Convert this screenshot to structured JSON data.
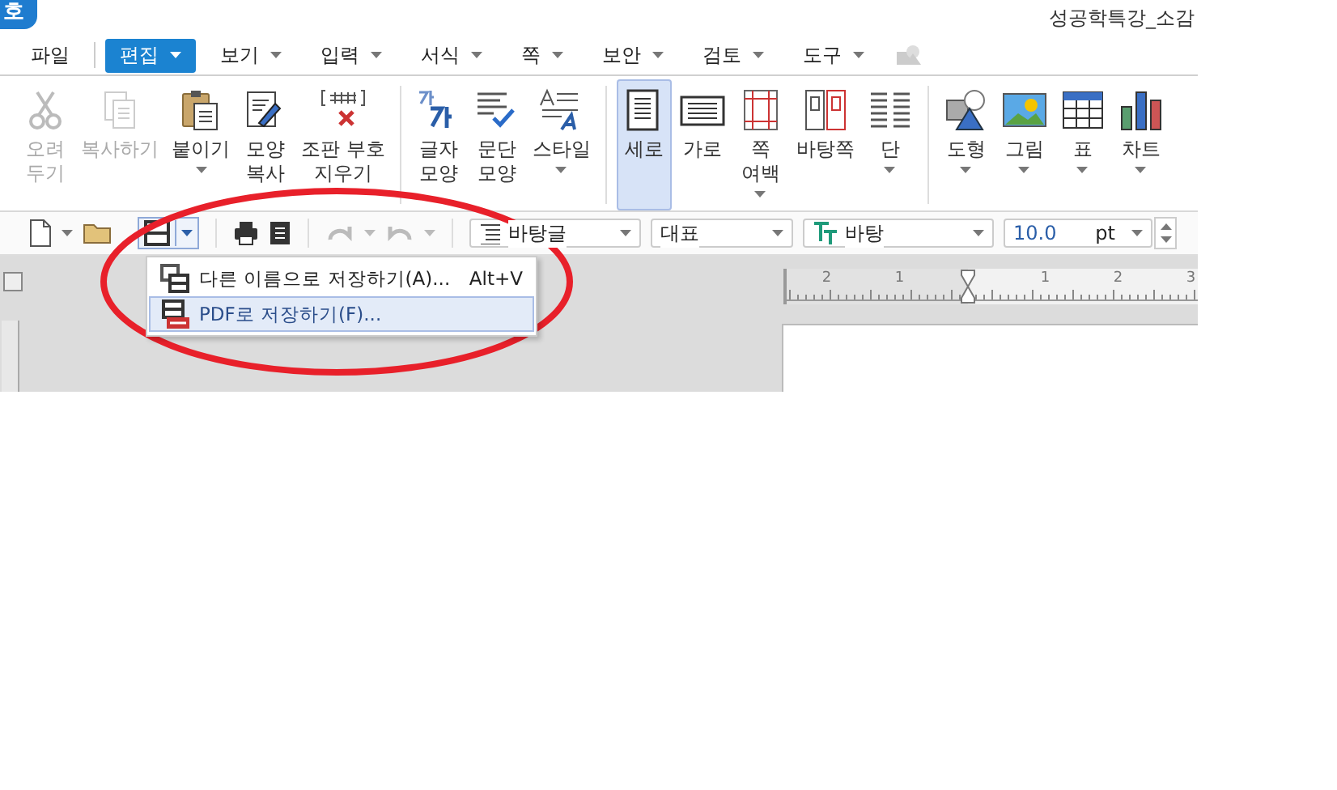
{
  "window": {
    "app_badge": "호",
    "title": "성공학특강_소감"
  },
  "menu_tabs": [
    {
      "label": "파일",
      "selected": false,
      "has_menu": false
    },
    {
      "label": "편집",
      "selected": true,
      "has_menu": true
    },
    {
      "label": "보기",
      "selected": false,
      "has_menu": true
    },
    {
      "label": "입력",
      "selected": false,
      "has_menu": true
    },
    {
      "label": "서식",
      "selected": false,
      "has_menu": true
    },
    {
      "label": "쪽",
      "selected": false,
      "has_menu": true
    },
    {
      "label": "보안",
      "selected": false,
      "has_menu": true
    },
    {
      "label": "검토",
      "selected": false,
      "has_menu": true
    },
    {
      "label": "도구",
      "selected": false,
      "has_menu": true
    }
  ],
  "ribbon": [
    [
      {
        "label": "오려\n두기",
        "disabled": true,
        "selected": false,
        "has_menu": false
      },
      {
        "label": "복사하기",
        "disabled": true,
        "selected": false,
        "has_menu": false
      },
      {
        "label": "붙이기",
        "disabled": false,
        "selected": false,
        "has_menu": true
      },
      {
        "label": "모양\n복사",
        "disabled": false,
        "selected": false,
        "has_menu": false
      },
      {
        "label": "조판 부호\n지우기",
        "disabled": false,
        "selected": false,
        "has_menu": false
      }
    ],
    [
      {
        "label": "글자\n모양",
        "disabled": false,
        "selected": false,
        "has_menu": false
      },
      {
        "label": "문단\n모양",
        "disabled": false,
        "selected": false,
        "has_menu": false
      },
      {
        "label": "스타일",
        "disabled": false,
        "selected": false,
        "has_menu": true
      }
    ],
    [
      {
        "label": "세로",
        "disabled": false,
        "selected": true,
        "has_menu": false
      },
      {
        "label": "가로",
        "disabled": false,
        "selected": false,
        "has_menu": false
      },
      {
        "label": "쪽\n여백",
        "disabled": false,
        "selected": false,
        "has_menu": true
      },
      {
        "label": "바탕쪽",
        "disabled": false,
        "selected": false,
        "has_menu": false
      },
      {
        "label": "단",
        "disabled": false,
        "selected": false,
        "has_menu": true
      }
    ],
    [
      {
        "label": "도형",
        "disabled": false,
        "selected": false,
        "has_menu": true
      },
      {
        "label": "그림",
        "disabled": false,
        "selected": false,
        "has_menu": true
      },
      {
        "label": "표",
        "disabled": false,
        "selected": false,
        "has_menu": true
      },
      {
        "label": "차트",
        "disabled": false,
        "selected": false,
        "has_menu": true
      }
    ]
  ],
  "toolbar": {
    "style_combo": "바탕글",
    "outline_combo": "대표",
    "font_combo": "바탕",
    "size_value": "10.0",
    "size_unit": "pt",
    "undo_disabled": true,
    "redo_disabled": true,
    "save_pressed": true
  },
  "save_menu": [
    {
      "label": "다른 이름으로 저장하기(A)...",
      "shortcut": "Alt+V",
      "selected": false
    },
    {
      "label": "PDF로 저장하기(F)...",
      "selected": true
    }
  ],
  "ruler_labels": [
    "2",
    "1",
    "1",
    "2",
    "3"
  ],
  "annotation": {
    "kind": "ellipse"
  }
}
